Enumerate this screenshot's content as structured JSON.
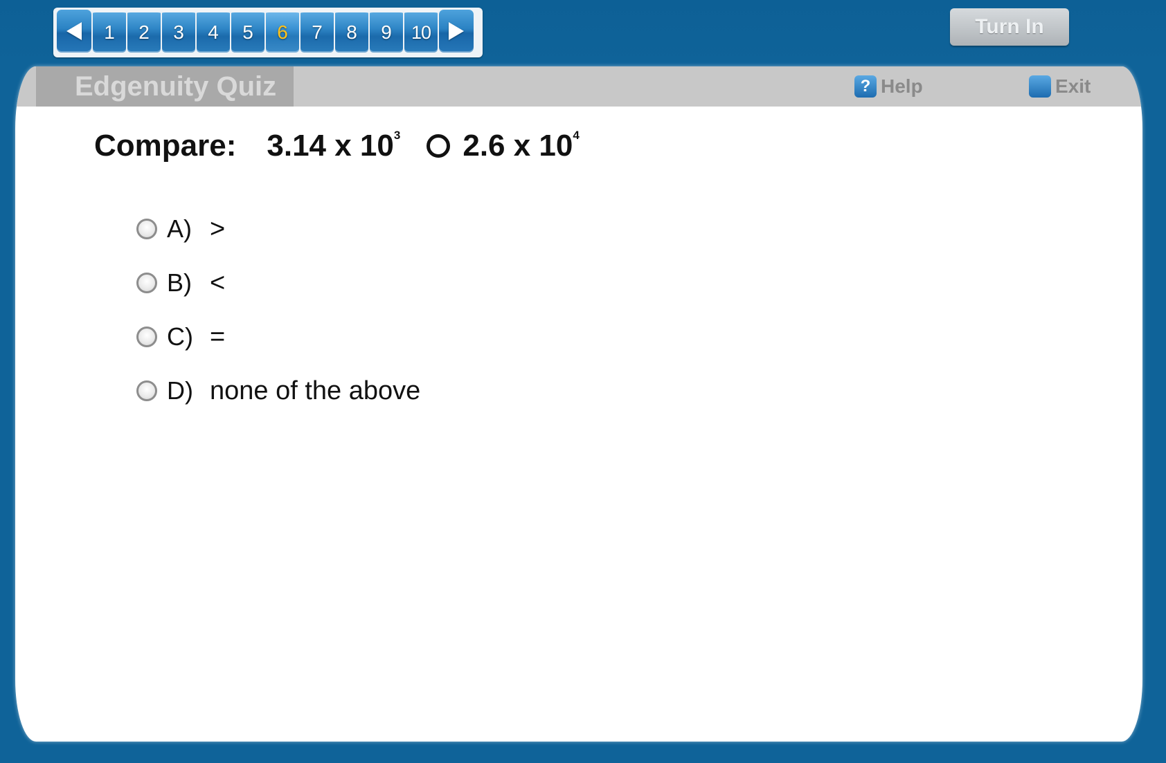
{
  "nav": {
    "prev_icon": "triangle-left-icon",
    "next_icon": "triangle-right-icon",
    "questions": [
      "1",
      "2",
      "3",
      "4",
      "5",
      "6",
      "7",
      "8",
      "9",
      "10"
    ],
    "current": "6",
    "current_color": "#ffc21a"
  },
  "toolbar": {
    "turn_in_label": "Turn In"
  },
  "header": {
    "title": "Edgenuity Quiz",
    "help_icon_glyph": "?",
    "help_label": "Help",
    "exit_label": "Exit"
  },
  "question": {
    "label": "Compare:",
    "left_base": "3.14 x 10",
    "left_exp": "3",
    "right_base": "2.6 x 10",
    "right_exp": "4"
  },
  "options": [
    {
      "letter": "A)",
      "text": ">"
    },
    {
      "letter": "B)",
      "text": "<"
    },
    {
      "letter": "C)",
      "text": "="
    },
    {
      "letter": "D)",
      "text": "none of the above"
    }
  ],
  "colors": {
    "background": "#0f6399",
    "nav_button": "#2f86c6",
    "header_bar": "#c8c8c8"
  }
}
